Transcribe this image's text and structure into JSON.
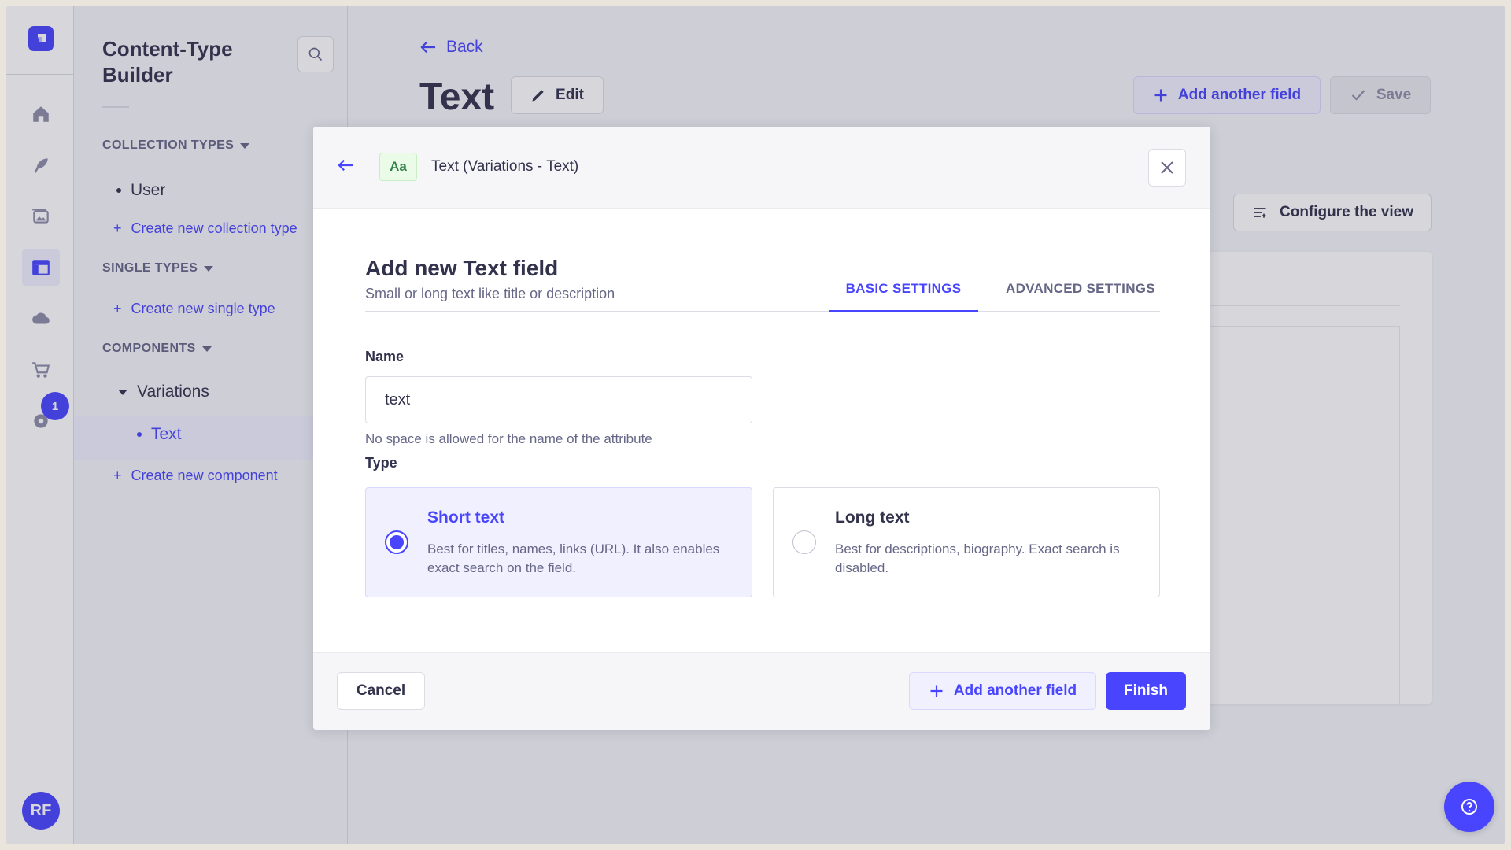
{
  "colors": {
    "primary": "#4945ff",
    "primary_light": "#f0f0ff",
    "text": "#32324d",
    "muted": "#666687"
  },
  "nav": {
    "icons": [
      "strapi-logo-icon",
      "home-icon",
      "feather-icon",
      "media-icon",
      "layout-icon",
      "cloud-icon",
      "cart-icon",
      "gear-icon"
    ],
    "notification_badge": "1",
    "avatar_initials": "RF"
  },
  "subnav": {
    "title": "Content-Type Builder",
    "collection_types": {
      "label": "COLLECTION TYPES",
      "items": [
        "User"
      ],
      "create_label": "Create new collection type"
    },
    "single_types": {
      "label": "SINGLE TYPES",
      "create_label": "Create new single type"
    },
    "components": {
      "label": "COMPONENTS",
      "group": "Variations",
      "items": [
        "Text"
      ],
      "create_label": "Create new component"
    }
  },
  "main": {
    "back_label": "Back",
    "title": "Text",
    "edit_label": "Edit",
    "add_field_label": "Add another field",
    "save_label": "Save",
    "configure_label": "Configure the view"
  },
  "modal": {
    "breadcrumb": "Text (Variations - Text)",
    "type_icon_text": "Aa",
    "heading": "Add new Text field",
    "subheading": "Small or long text like title or description",
    "tabs": [
      {
        "label": "BASIC SETTINGS",
        "active": true
      },
      {
        "label": "ADVANCED SETTINGS",
        "active": false
      }
    ],
    "name_label": "Name",
    "name_value": "text",
    "name_hint": "No space is allowed for the name of the attribute",
    "type_label": "Type",
    "type_options": [
      {
        "title": "Short text",
        "description": "Best for titles, names, links (URL). It also enables exact search on the field.",
        "selected": true
      },
      {
        "title": "Long text",
        "description": "Best for descriptions, biography. Exact search is disabled.",
        "selected": false
      }
    ],
    "cancel_label": "Cancel",
    "add_field_label": "Add another field",
    "finish_label": "Finish"
  }
}
